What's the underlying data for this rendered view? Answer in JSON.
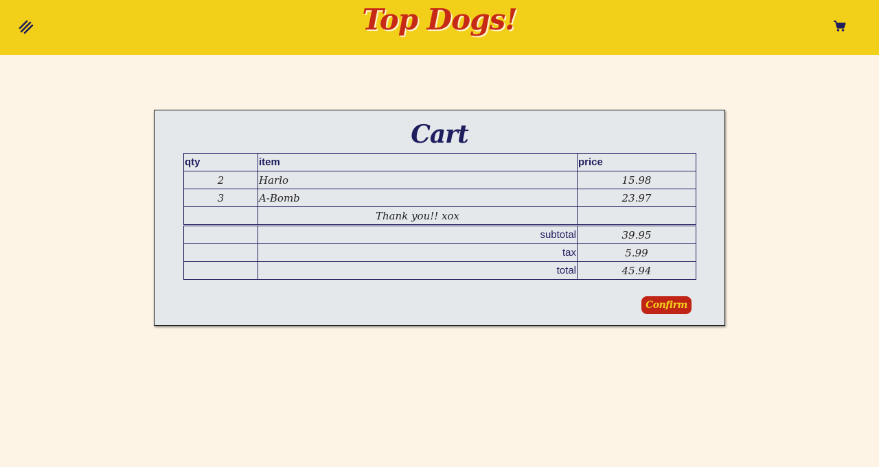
{
  "header": {
    "brand": "Top Dogs!",
    "menu_icon": "hotdog-stripes-icon",
    "cart_icon": "shopping-cart-icon",
    "colors": {
      "bar": "#f2cf19",
      "brand": "#c62a16",
      "icons": "#1e1d5e"
    }
  },
  "cart": {
    "title": "Cart",
    "columns": [
      "qty",
      "item",
      "price"
    ],
    "rows": [
      {
        "qty": "2",
        "item": "Harlo",
        "price": "15.98"
      },
      {
        "qty": "3",
        "item": "A-Bomb",
        "price": "23.97"
      }
    ],
    "note": "Thank you!! xox",
    "summary": [
      {
        "label": "subtotal",
        "value": "39.95"
      },
      {
        "label": "tax",
        "value": "5.99"
      },
      {
        "label": "total",
        "value": "45.94"
      }
    ],
    "confirm_label": "Confirm",
    "colors": {
      "ink": "#1e1d5e",
      "button": "#c02415",
      "button_text": "#f2cf19"
    }
  }
}
